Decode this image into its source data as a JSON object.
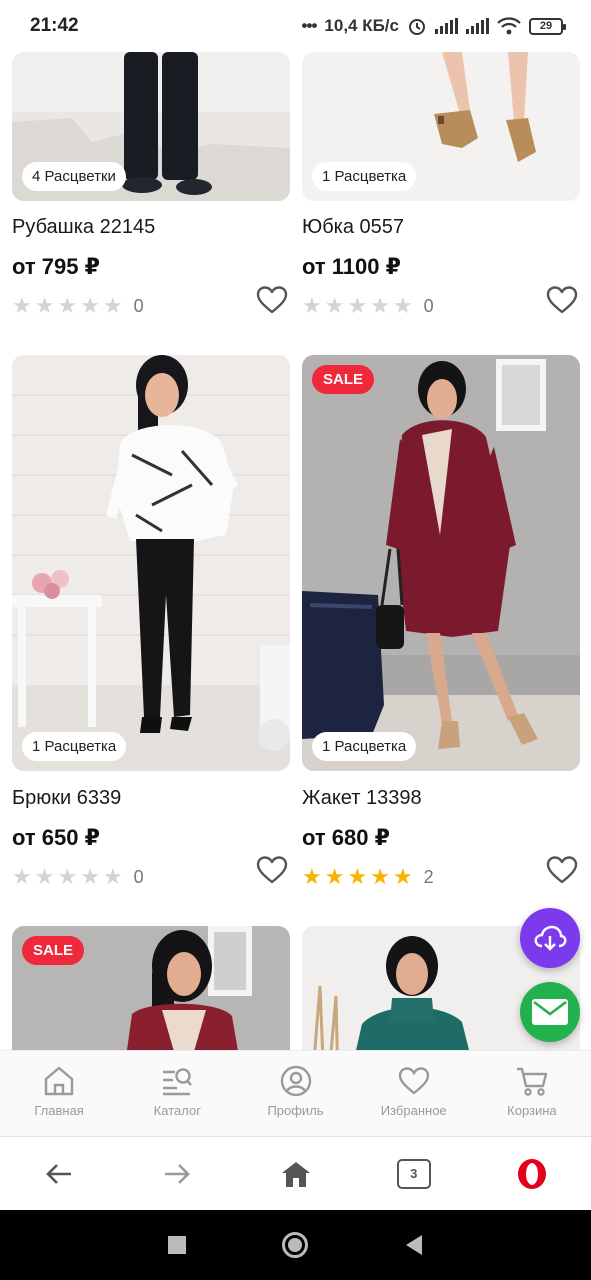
{
  "status_bar": {
    "time": "21:42",
    "speed": "10,4 КБ/с",
    "battery": "29"
  },
  "products": [
    {
      "name": "Рубашка 22145",
      "price": "от 795 ₽",
      "variants": "4 Расцветки",
      "sale": false,
      "rating_stars": 0,
      "review_count": "0"
    },
    {
      "name": "Юбка 0557",
      "price": "от 1100 ₽",
      "variants": "1 Расцветка",
      "sale": false,
      "rating_stars": 0,
      "review_count": "0"
    },
    {
      "name": "Брюки 6339",
      "price": "от 650 ₽",
      "variants": "1 Расцветка",
      "sale": false,
      "rating_stars": 0,
      "review_count": "0"
    },
    {
      "name": "Жакет 13398",
      "price": "от 680 ₽",
      "variants": "1 Расцветка",
      "sale": true,
      "sale_label": "SALE",
      "rating_stars": 5,
      "review_count": "2"
    },
    {
      "sale": true,
      "sale_label": "SALE"
    },
    {
      "sale": false
    }
  ],
  "app_nav": {
    "items": [
      {
        "label": "Главная",
        "icon": "home-icon"
      },
      {
        "label": "Каталог",
        "icon": "catalog-search-icon"
      },
      {
        "label": "Профиль",
        "icon": "profile-icon"
      },
      {
        "label": "Избранное",
        "icon": "heart-icon"
      },
      {
        "label": "Корзина",
        "icon": "cart-icon"
      }
    ]
  },
  "browser_bar": {
    "tab_count": "3"
  },
  "colors": {
    "sale": "#f0283c",
    "star_active": "#f7b400",
    "star_inactive": "#d4d4d4",
    "fab_upload": "#7c3aed",
    "fab_mail": "#22b14c",
    "opera_red": "#e3001b"
  }
}
